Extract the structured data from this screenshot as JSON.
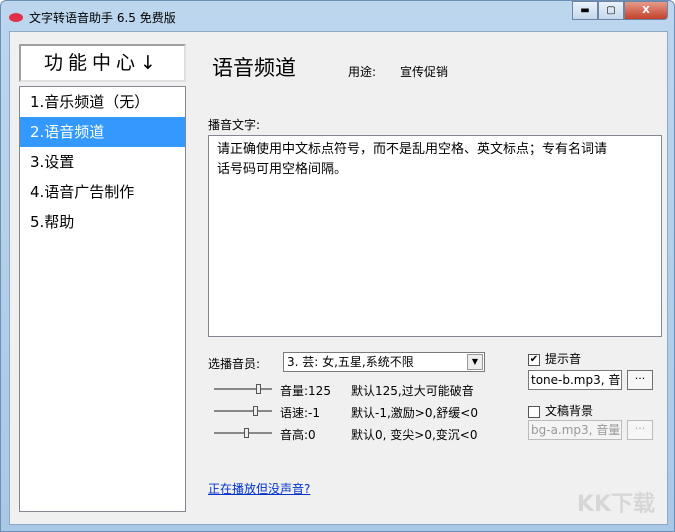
{
  "window": {
    "title": "文字转语音助手 6.5 免费版",
    "minimize": "▬",
    "maximize": "▢",
    "close": "X"
  },
  "sidebar": {
    "header": "功能中心↓",
    "items": [
      {
        "label": "1.音乐频道（无）"
      },
      {
        "label": "2.语音频道"
      },
      {
        "label": "3.设置"
      },
      {
        "label": "4.语音广告制作"
      },
      {
        "label": "5.帮助"
      }
    ],
    "selected_index": 1
  },
  "main": {
    "title": "语音频道",
    "usage_label": "用途:",
    "usage_value": "宣传促销",
    "text_label": "播音文字:",
    "text_value": "请正确使用中文标点符号，而不是乱用空格、英文标点；专有名词请\n话号码可用空格间隔。",
    "voice_label": "选播音员:",
    "voice_value": "3. 芸: 女,五星,系统不限",
    "sliders": [
      {
        "label": "音量:125",
        "hint": "默认125,过大可能破音",
        "value": 125,
        "position": 0.75
      },
      {
        "label": "语速:-1",
        "hint": "默认-1,激励>0,舒缓<0",
        "value": -1,
        "position": 0.7
      },
      {
        "label": "音高:0",
        "hint": "默认0, 变尖>0,变沉<0",
        "value": 0,
        "position": 0.5
      }
    ],
    "prompt_tone": {
      "label": "提示音",
      "checked": true,
      "value": "tone-b.mp3, 音",
      "browse": "···"
    },
    "background": {
      "label": "文稿背景",
      "checked": false,
      "value": "bg-a.mp3, 音量",
      "browse": "···"
    },
    "help_link": "正在播放但没声音?"
  },
  "watermark": "KK下载"
}
